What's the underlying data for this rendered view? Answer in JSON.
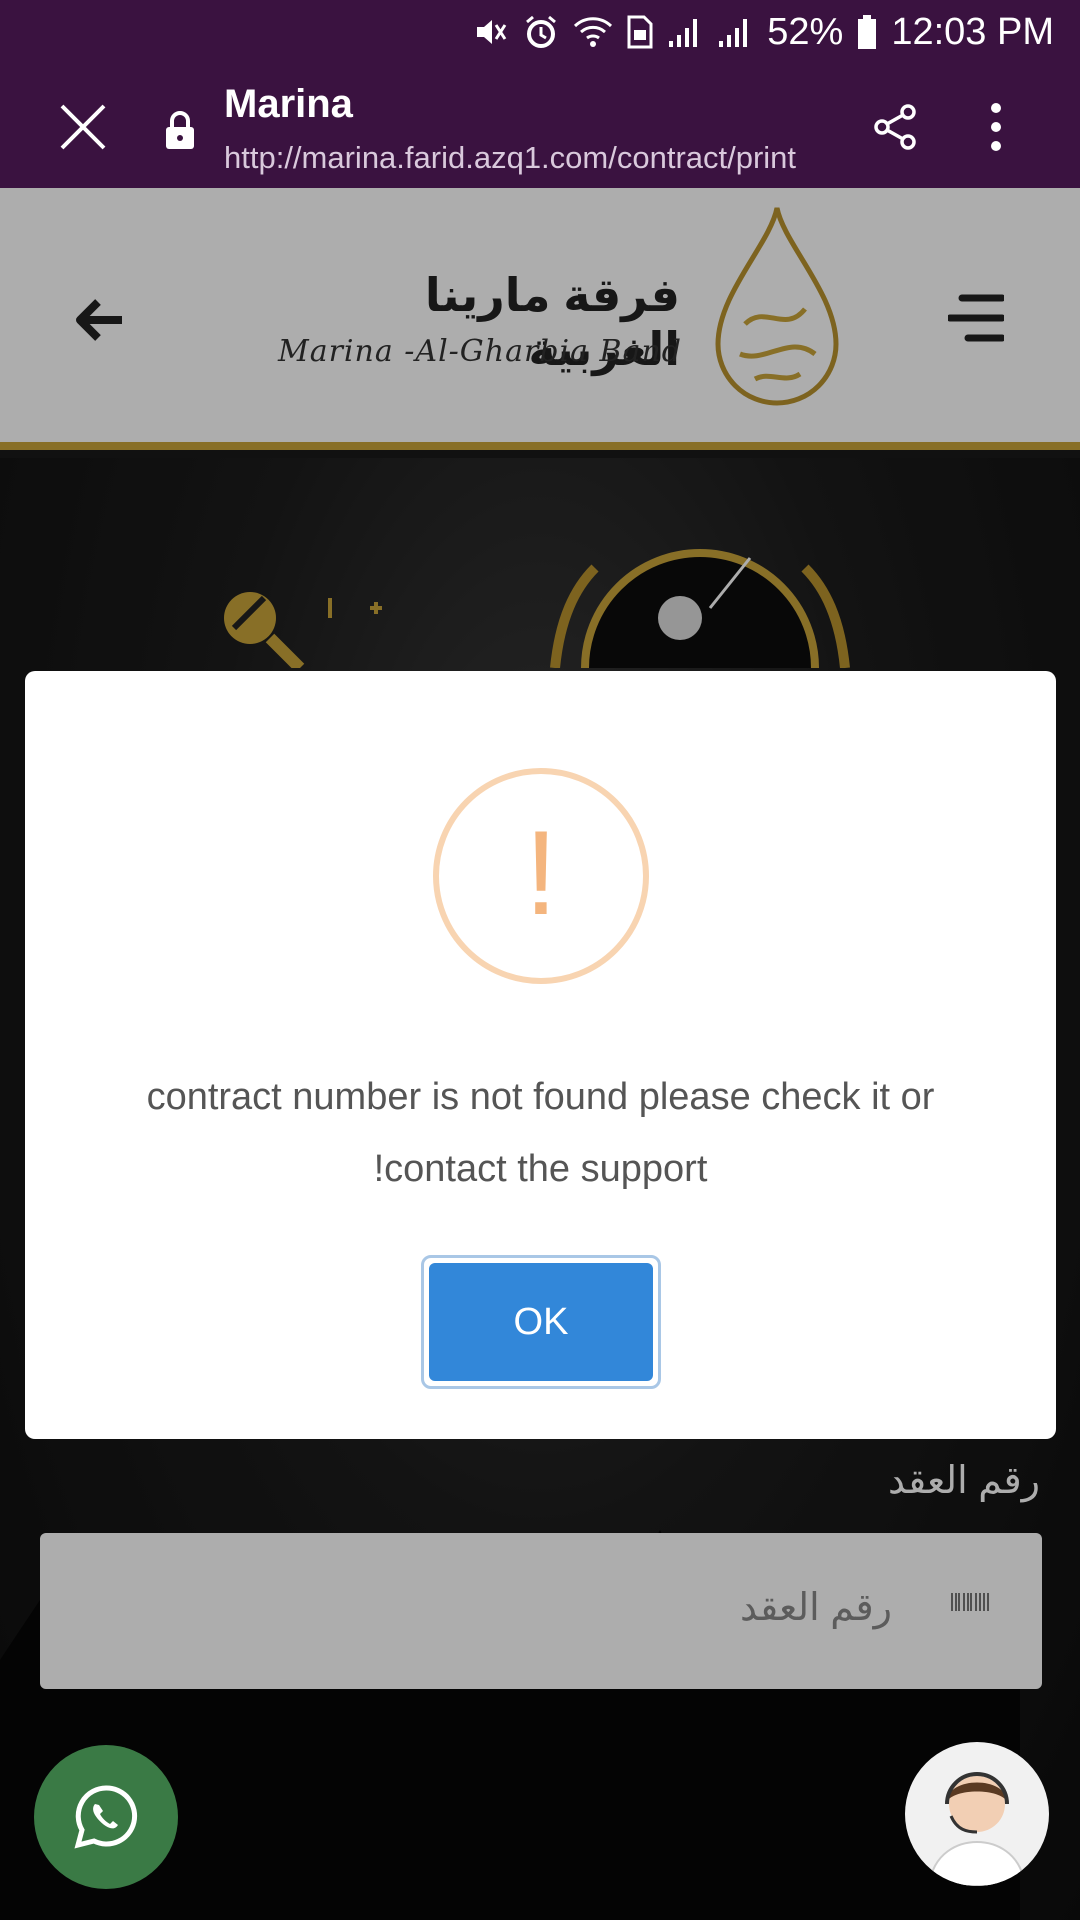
{
  "status_bar": {
    "battery": "52%",
    "time": "12:03 PM",
    "icons": [
      "mute-icon",
      "alarm-icon",
      "wifi-icon",
      "sim-icon",
      "signal-icon",
      "signal-icon",
      "battery-icon"
    ]
  },
  "browser": {
    "title": "Marina",
    "url": "http://marina.farid.azq1.com/contract/print",
    "toolbar_color": "#3a1240"
  },
  "site": {
    "brand_arabic": "فرقة مارينا الغربية",
    "brand_english": "Marina -Al-Gharbia Band",
    "accent_color": "#c9a43a",
    "contract_label": "رقم العقد",
    "contract_placeholder": "رقم العقد"
  },
  "dialog": {
    "icon": "warning-exclamation-icon",
    "icon_glyph": "!",
    "message": "contract number is not found please check it or !contact the support",
    "ok_label": "OK",
    "ok_color": "#3287d9"
  },
  "floating": {
    "whatsapp_color": "#3a7a45"
  }
}
